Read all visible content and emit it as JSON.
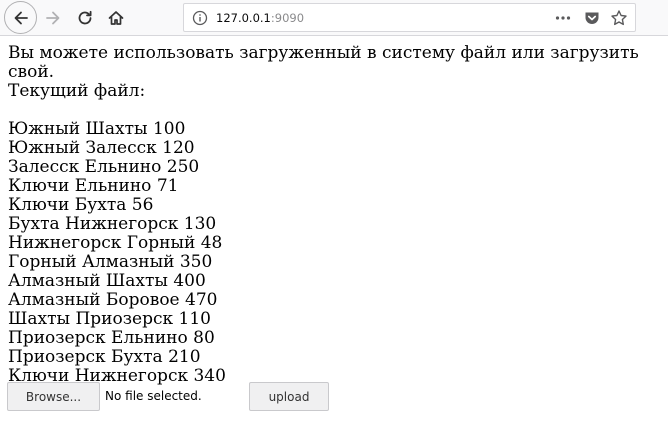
{
  "browser": {
    "url_host": "127.0.0.1",
    "url_port": ":9090",
    "icons": [
      "back-arrow-icon",
      "forward-arrow-icon",
      "reload-icon",
      "home-icon",
      "info-icon",
      "more-dots-icon",
      "pocket-icon",
      "star-icon"
    ]
  },
  "page": {
    "intro_line1": "Вы можете использовать загруженный в систему файл или загрузить свой.",
    "intro_line2": "Текущий файл:",
    "routes": [
      "Южный Шахты 100",
      "Южный Залесск 120",
      "Залесск Ельнино 250",
      "Ключи Ельнино 71",
      "Ключи Бухта 56",
      "Бухта Нижнегорск 130",
      "Нижнегорск Горный 48",
      "Горный Алмазный 350",
      "Алмазный Шахты 400",
      "Алмазный Боровое 470",
      "Шахты Приозерск 110",
      "Приозерск Ельнино 80",
      "Приозерск Бухта 210",
      "Ключи Нижнегорск 340"
    ]
  },
  "form": {
    "browse_label": "Browse...",
    "file_status": "No file selected.",
    "upload_label": "upload"
  }
}
